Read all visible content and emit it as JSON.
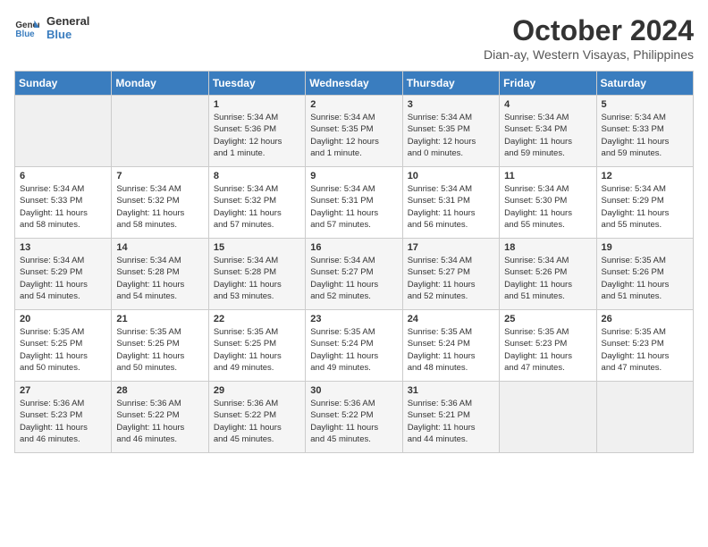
{
  "header": {
    "logo_line1": "General",
    "logo_line2": "Blue",
    "month": "October 2024",
    "location": "Dian-ay, Western Visayas, Philippines"
  },
  "weekdays": [
    "Sunday",
    "Monday",
    "Tuesday",
    "Wednesday",
    "Thursday",
    "Friday",
    "Saturday"
  ],
  "weeks": [
    [
      {
        "day": "",
        "info": ""
      },
      {
        "day": "",
        "info": ""
      },
      {
        "day": "1",
        "info": "Sunrise: 5:34 AM\nSunset: 5:36 PM\nDaylight: 12 hours\nand 1 minute."
      },
      {
        "day": "2",
        "info": "Sunrise: 5:34 AM\nSunset: 5:35 PM\nDaylight: 12 hours\nand 1 minute."
      },
      {
        "day": "3",
        "info": "Sunrise: 5:34 AM\nSunset: 5:35 PM\nDaylight: 12 hours\nand 0 minutes."
      },
      {
        "day": "4",
        "info": "Sunrise: 5:34 AM\nSunset: 5:34 PM\nDaylight: 11 hours\nand 59 minutes."
      },
      {
        "day": "5",
        "info": "Sunrise: 5:34 AM\nSunset: 5:33 PM\nDaylight: 11 hours\nand 59 minutes."
      }
    ],
    [
      {
        "day": "6",
        "info": "Sunrise: 5:34 AM\nSunset: 5:33 PM\nDaylight: 11 hours\nand 58 minutes."
      },
      {
        "day": "7",
        "info": "Sunrise: 5:34 AM\nSunset: 5:32 PM\nDaylight: 11 hours\nand 58 minutes."
      },
      {
        "day": "8",
        "info": "Sunrise: 5:34 AM\nSunset: 5:32 PM\nDaylight: 11 hours\nand 57 minutes."
      },
      {
        "day": "9",
        "info": "Sunrise: 5:34 AM\nSunset: 5:31 PM\nDaylight: 11 hours\nand 57 minutes."
      },
      {
        "day": "10",
        "info": "Sunrise: 5:34 AM\nSunset: 5:31 PM\nDaylight: 11 hours\nand 56 minutes."
      },
      {
        "day": "11",
        "info": "Sunrise: 5:34 AM\nSunset: 5:30 PM\nDaylight: 11 hours\nand 55 minutes."
      },
      {
        "day": "12",
        "info": "Sunrise: 5:34 AM\nSunset: 5:29 PM\nDaylight: 11 hours\nand 55 minutes."
      }
    ],
    [
      {
        "day": "13",
        "info": "Sunrise: 5:34 AM\nSunset: 5:29 PM\nDaylight: 11 hours\nand 54 minutes."
      },
      {
        "day": "14",
        "info": "Sunrise: 5:34 AM\nSunset: 5:28 PM\nDaylight: 11 hours\nand 54 minutes."
      },
      {
        "day": "15",
        "info": "Sunrise: 5:34 AM\nSunset: 5:28 PM\nDaylight: 11 hours\nand 53 minutes."
      },
      {
        "day": "16",
        "info": "Sunrise: 5:34 AM\nSunset: 5:27 PM\nDaylight: 11 hours\nand 52 minutes."
      },
      {
        "day": "17",
        "info": "Sunrise: 5:34 AM\nSunset: 5:27 PM\nDaylight: 11 hours\nand 52 minutes."
      },
      {
        "day": "18",
        "info": "Sunrise: 5:34 AM\nSunset: 5:26 PM\nDaylight: 11 hours\nand 51 minutes."
      },
      {
        "day": "19",
        "info": "Sunrise: 5:35 AM\nSunset: 5:26 PM\nDaylight: 11 hours\nand 51 minutes."
      }
    ],
    [
      {
        "day": "20",
        "info": "Sunrise: 5:35 AM\nSunset: 5:25 PM\nDaylight: 11 hours\nand 50 minutes."
      },
      {
        "day": "21",
        "info": "Sunrise: 5:35 AM\nSunset: 5:25 PM\nDaylight: 11 hours\nand 50 minutes."
      },
      {
        "day": "22",
        "info": "Sunrise: 5:35 AM\nSunset: 5:25 PM\nDaylight: 11 hours\nand 49 minutes."
      },
      {
        "day": "23",
        "info": "Sunrise: 5:35 AM\nSunset: 5:24 PM\nDaylight: 11 hours\nand 49 minutes."
      },
      {
        "day": "24",
        "info": "Sunrise: 5:35 AM\nSunset: 5:24 PM\nDaylight: 11 hours\nand 48 minutes."
      },
      {
        "day": "25",
        "info": "Sunrise: 5:35 AM\nSunset: 5:23 PM\nDaylight: 11 hours\nand 47 minutes."
      },
      {
        "day": "26",
        "info": "Sunrise: 5:35 AM\nSunset: 5:23 PM\nDaylight: 11 hours\nand 47 minutes."
      }
    ],
    [
      {
        "day": "27",
        "info": "Sunrise: 5:36 AM\nSunset: 5:23 PM\nDaylight: 11 hours\nand 46 minutes."
      },
      {
        "day": "28",
        "info": "Sunrise: 5:36 AM\nSunset: 5:22 PM\nDaylight: 11 hours\nand 46 minutes."
      },
      {
        "day": "29",
        "info": "Sunrise: 5:36 AM\nSunset: 5:22 PM\nDaylight: 11 hours\nand 45 minutes."
      },
      {
        "day": "30",
        "info": "Sunrise: 5:36 AM\nSunset: 5:22 PM\nDaylight: 11 hours\nand 45 minutes."
      },
      {
        "day": "31",
        "info": "Sunrise: 5:36 AM\nSunset: 5:21 PM\nDaylight: 11 hours\nand 44 minutes."
      },
      {
        "day": "",
        "info": ""
      },
      {
        "day": "",
        "info": ""
      }
    ]
  ]
}
